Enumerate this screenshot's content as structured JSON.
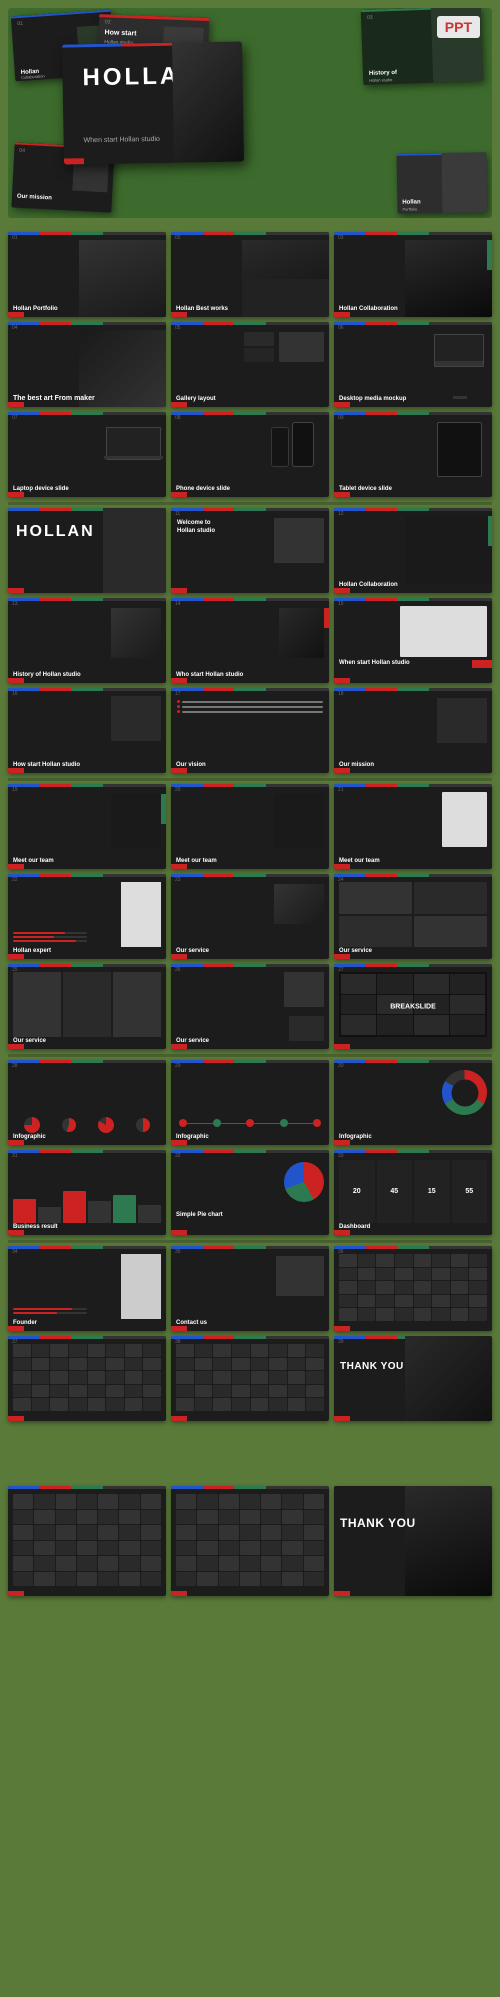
{
  "badge": {
    "label": "PPT"
  },
  "page": {
    "bg_color": "#5a7a3a"
  },
  "hero": {
    "main_title": "HOLLAN",
    "subtitle": "When start Hollan studio"
  },
  "slides": [
    {
      "id": 1,
      "title": "Hollan Portfolio",
      "type": "dark"
    },
    {
      "id": 2,
      "title": "Hollan Best works",
      "type": "dark"
    },
    {
      "id": 3,
      "title": "Hollan Collaboration",
      "type": "dark"
    },
    {
      "id": 4,
      "title": "The best art From maker",
      "type": "dark"
    },
    {
      "id": 5,
      "title": "Gallery layout",
      "type": "dark"
    },
    {
      "id": 6,
      "title": "Desktop media mockup",
      "type": "dark"
    },
    {
      "id": 7,
      "title": "Laptop device slide",
      "type": "dark"
    },
    {
      "id": 8,
      "title": "Phone device slide",
      "type": "dark"
    },
    {
      "id": 9,
      "title": "Tablet device slide",
      "type": "dark"
    },
    {
      "id": 10,
      "title": "HOLLAN",
      "type": "dark"
    },
    {
      "id": 11,
      "title": "Welcome to Hollan studio",
      "type": "dark"
    },
    {
      "id": 12,
      "title": "Hollan Collaboration",
      "type": "dark"
    },
    {
      "id": 13,
      "title": "History of Hollan studio",
      "type": "dark"
    },
    {
      "id": 14,
      "title": "Who start Hollan studio",
      "type": "dark"
    },
    {
      "id": 15,
      "title": "When start Hollan studio",
      "type": "dark"
    },
    {
      "id": 16,
      "title": "How start Hollan studio",
      "type": "dark"
    },
    {
      "id": 17,
      "title": "Our vision",
      "type": "dark"
    },
    {
      "id": 18,
      "title": "Our mission",
      "type": "dark"
    },
    {
      "id": 19,
      "title": "Meet our team",
      "type": "dark"
    },
    {
      "id": 20,
      "title": "Meet our team",
      "type": "dark"
    },
    {
      "id": 21,
      "title": "Meet our team",
      "type": "dark"
    },
    {
      "id": 22,
      "title": "Hollan expert",
      "type": "dark"
    },
    {
      "id": 23,
      "title": "Our service",
      "type": "dark"
    },
    {
      "id": 24,
      "title": "Our service",
      "type": "dark"
    },
    {
      "id": 25,
      "title": "Our service",
      "type": "dark"
    },
    {
      "id": 26,
      "title": "Our service",
      "type": "dark"
    },
    {
      "id": 27,
      "title": "BREAKSLIDE",
      "type": "dark"
    },
    {
      "id": 28,
      "title": "Infographic",
      "type": "dark"
    },
    {
      "id": 29,
      "title": "Infographic",
      "type": "dark"
    },
    {
      "id": 30,
      "title": "Infographic",
      "type": "dark"
    },
    {
      "id": 31,
      "title": "Business result",
      "type": "dark"
    },
    {
      "id": 32,
      "title": "Simple Pie chart",
      "type": "dark"
    },
    {
      "id": 33,
      "title": "Dashboard",
      "type": "dark"
    },
    {
      "id": 34,
      "title": "Founder",
      "type": "dark"
    },
    {
      "id": 35,
      "title": "Contact us",
      "type": "dark"
    },
    {
      "id": 36,
      "title": "Icons",
      "type": "dark"
    },
    {
      "id": 37,
      "title": "Icons",
      "type": "dark"
    },
    {
      "id": 38,
      "title": "Icons",
      "type": "dark"
    },
    {
      "id": 39,
      "title": "Thank You",
      "type": "dark"
    }
  ],
  "thankyou": {
    "label": "THANK YOU"
  },
  "dashboard_numbers": [
    "20",
    "45",
    "15",
    "55"
  ]
}
